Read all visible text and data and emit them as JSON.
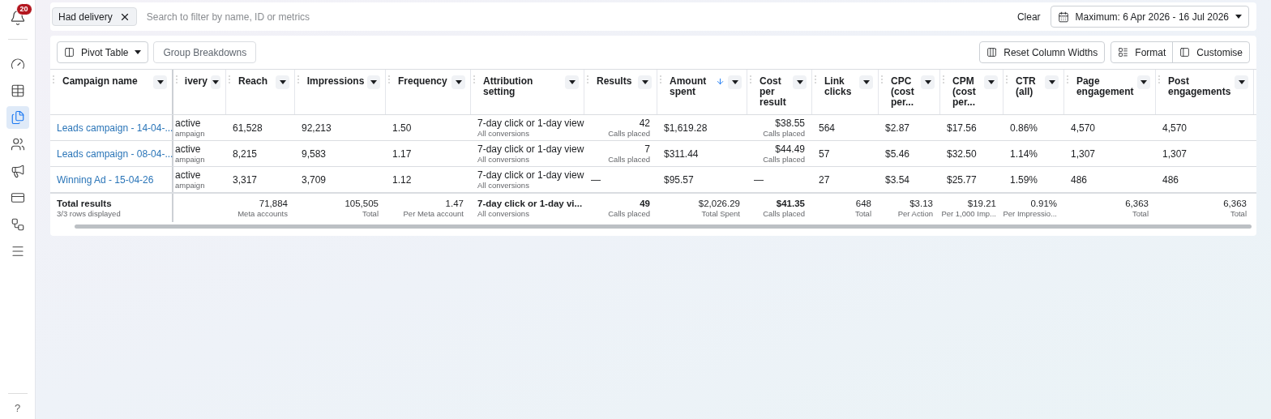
{
  "sidebar": {
    "badge": "20",
    "items": [
      {
        "kind": "dashboard",
        "selected": false
      },
      {
        "kind": "table",
        "selected": false
      },
      {
        "kind": "pages",
        "selected": true
      },
      {
        "kind": "audience",
        "selected": false
      },
      {
        "kind": "ads",
        "selected": false
      },
      {
        "kind": "billing",
        "selected": false
      },
      {
        "kind": "network",
        "selected": false
      },
      {
        "kind": "menu",
        "selected": false
      }
    ],
    "help": "?"
  },
  "filter_bar": {
    "chip": "Had delivery",
    "placeholder": "Search to filter by name, ID or metrics",
    "clear": "Clear",
    "date_range": "Maximum: 6 Apr 2026 - 16 Jul 2026"
  },
  "toolbar": {
    "pivot": "Pivot Table",
    "group": "Group Breakdowns",
    "reset": "Reset Column Widths",
    "format": "Format",
    "customise": "Customise"
  },
  "table": {
    "columns": [
      {
        "label": "Campaign name",
        "kind": "plain",
        "sorted": false
      },
      {
        "label": "ivery",
        "kind": "plain",
        "sorted": false
      },
      {
        "label": "Reach",
        "kind": "plain",
        "sorted": false
      },
      {
        "label": "Impressions",
        "kind": "plain",
        "sorted": false
      },
      {
        "label": "Frequency",
        "kind": "plain",
        "sorted": false
      },
      {
        "label": "Attribution setting",
        "kind": "plain",
        "sorted": false
      },
      {
        "label": "Results",
        "kind": "result",
        "sorted": false
      },
      {
        "label": "Amount spent",
        "kind": "plain",
        "sorted": true
      },
      {
        "label": "Cost per result",
        "kind": "result",
        "sorted": false
      },
      {
        "label": "Link clicks",
        "kind": "plain",
        "sorted": false
      },
      {
        "label": "CPC (cost per...",
        "kind": "plain",
        "sorted": false
      },
      {
        "label": "CPM (cost per...",
        "kind": "plain",
        "sorted": false
      },
      {
        "label": "CTR (all)",
        "kind": "plain",
        "sorted": false
      },
      {
        "label": "Page engagement",
        "kind": "plain",
        "sorted": false
      },
      {
        "label": "Post engagements",
        "kind": "plain",
        "sorted": false
      }
    ],
    "rows": [
      {
        "cells": [
          {
            "text": "Leads campaign - 14-04-..."
          },
          {
            "text": "active",
            "sub": "ampaign"
          },
          {
            "text": "61,528"
          },
          {
            "text": "92,213"
          },
          {
            "text": "1.50"
          },
          {
            "text": "7-day click or 1-day view",
            "sub": "All conversions"
          },
          {
            "text": "42",
            "sub": "Calls placed"
          },
          {
            "text": "$1,619.28"
          },
          {
            "text": "$38.55",
            "sub": "Calls placed"
          },
          {
            "text": "564"
          },
          {
            "text": "$2.87"
          },
          {
            "text": "$17.56"
          },
          {
            "text": "0.86%"
          },
          {
            "text": "4,570"
          },
          {
            "text": "4,570"
          }
        ]
      },
      {
        "cells": [
          {
            "text": "Leads campaign - 08-04-..."
          },
          {
            "text": "active",
            "sub": "ampaign"
          },
          {
            "text": "8,215"
          },
          {
            "text": "9,583"
          },
          {
            "text": "1.17"
          },
          {
            "text": "7-day click or 1-day view",
            "sub": "All conversions"
          },
          {
            "text": "7",
            "sub": "Calls placed"
          },
          {
            "text": "$311.44"
          },
          {
            "text": "$44.49",
            "sub": "Calls placed"
          },
          {
            "text": "57"
          },
          {
            "text": "$5.46"
          },
          {
            "text": "$32.50"
          },
          {
            "text": "1.14%"
          },
          {
            "text": "1,307"
          },
          {
            "text": "1,307"
          }
        ]
      },
      {
        "cells": [
          {
            "text": "Winning Ad - 15-04-26"
          },
          {
            "text": "active",
            "sub": "ampaign"
          },
          {
            "text": "3,317"
          },
          {
            "text": "3,709"
          },
          {
            "text": "1.12"
          },
          {
            "text": "7-day click or 1-day view",
            "sub": "All conversions"
          },
          {
            "text": "—",
            "kind": "empty"
          },
          {
            "text": "$95.57"
          },
          {
            "text": "—",
            "kind": "empty"
          },
          {
            "text": "27"
          },
          {
            "text": "$3.54"
          },
          {
            "text": "$25.77"
          },
          {
            "text": "1.59%"
          },
          {
            "text": "486"
          },
          {
            "text": "486"
          }
        ]
      }
    ],
    "totals": [
      {
        "text": "Total results",
        "sub": "3/3 rows displayed",
        "kind": "label",
        "bold": true
      },
      {
        "kind": "blank"
      },
      {
        "text": "71,884",
        "sub": "Meta accounts",
        "kind": "metric",
        "bold": false
      },
      {
        "text": "105,505",
        "sub": "Total",
        "kind": "metric",
        "bold": false
      },
      {
        "text": "1.47",
        "sub": "Per Meta account",
        "kind": "metric",
        "bold": false
      },
      {
        "text": "7-day click or 1-day vi...",
        "sub": "All conversions",
        "kind": "label",
        "bold": true
      },
      {
        "text": "49",
        "sub": "Calls placed",
        "kind": "metric",
        "bold": true
      },
      {
        "text": "$2,026.29",
        "sub": "Total Spent",
        "kind": "metric",
        "bold": false
      },
      {
        "text": "$41.35",
        "sub": "Calls placed",
        "kind": "metric",
        "bold": true
      },
      {
        "text": "648",
        "sub": "Total",
        "kind": "metric",
        "bold": false
      },
      {
        "text": "$3.13",
        "sub": "Per Action",
        "kind": "metric",
        "bold": false
      },
      {
        "text": "$19.21",
        "sub": "Per 1,000 Imp...",
        "kind": "metric",
        "bold": false
      },
      {
        "text": "0.91%",
        "sub": "Per Impressio...",
        "kind": "metric",
        "bold": false
      },
      {
        "text": "6,363",
        "sub": "Total",
        "kind": "metric",
        "bold": false
      },
      {
        "text": "6,363",
        "sub": "Total",
        "kind": "metric",
        "bold": false
      }
    ]
  }
}
